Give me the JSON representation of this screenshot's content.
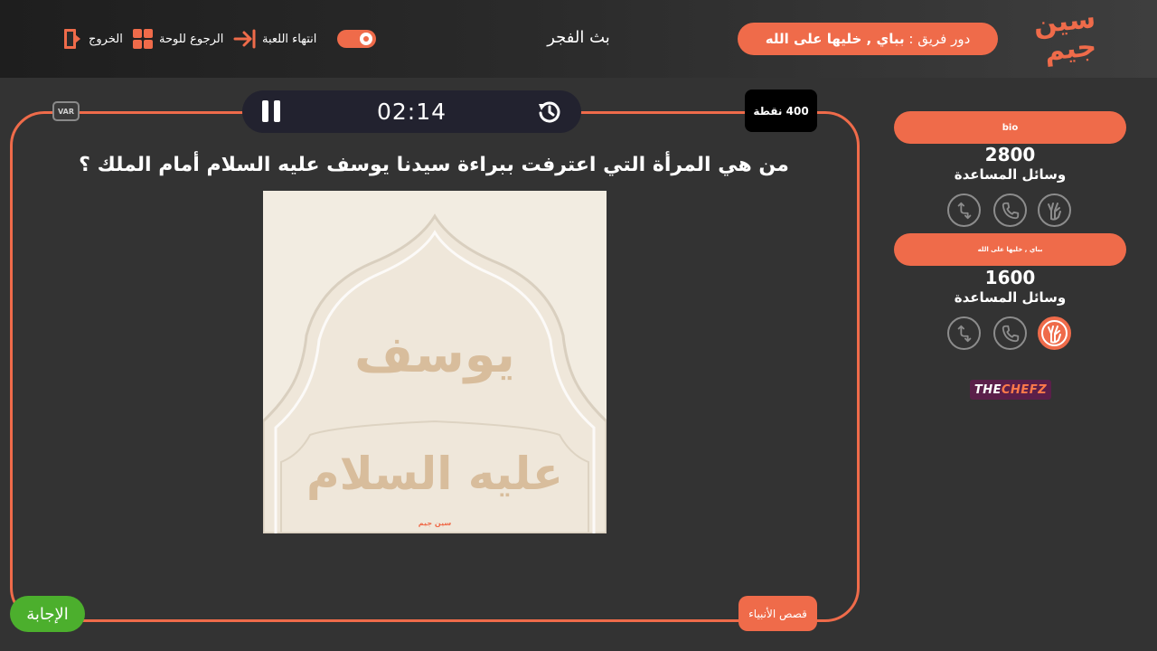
{
  "colors": {
    "accent": "#ef6b4a",
    "background": "#333333",
    "answer_green": "#4caf2d",
    "timer_bg": "#22222f"
  },
  "header": {
    "logo_text": "سين جيم",
    "turn_label": "دور فريق :",
    "turn_team": "بباي , خليها على الله",
    "game_title": "بث الفجر",
    "nav": {
      "exit_label": "الخروج",
      "board_label": "الرجوع للوحة",
      "end_game_label": "انتهاء اللعبة"
    },
    "toggle_on": true
  },
  "timer": {
    "time": "02:14"
  },
  "question": {
    "points": "400 نقطة",
    "var_label": "VAR",
    "text": "من هي المرأة التي اعترفت ببراءة سيدنا يوسف عليه السلام أمام الملك ؟",
    "image": {
      "line1": "يوسف",
      "line2": "عليه السلام",
      "watermark": "سين جيم"
    },
    "category": "قصص الأنبياء",
    "answer_label": "الإجابة"
  },
  "teams": [
    {
      "name": "bio",
      "score": "2800",
      "aids_label": "وسائل المساعدة",
      "aids": [
        {
          "icon": "hands-icon",
          "used": false
        },
        {
          "icon": "phone-icon",
          "used": false
        },
        {
          "icon": "switch-icon",
          "used": false
        }
      ]
    },
    {
      "name": "بباي , خليها على الله",
      "score": "1600",
      "aids_label": "وسائل المساعدة",
      "aids": [
        {
          "icon": "hands-icon",
          "used": true
        },
        {
          "icon": "phone-icon",
          "used": false
        },
        {
          "icon": "switch-icon",
          "used": false
        }
      ]
    }
  ],
  "sponsor": {
    "word1": "THE",
    "word2": "CHEFZ"
  }
}
